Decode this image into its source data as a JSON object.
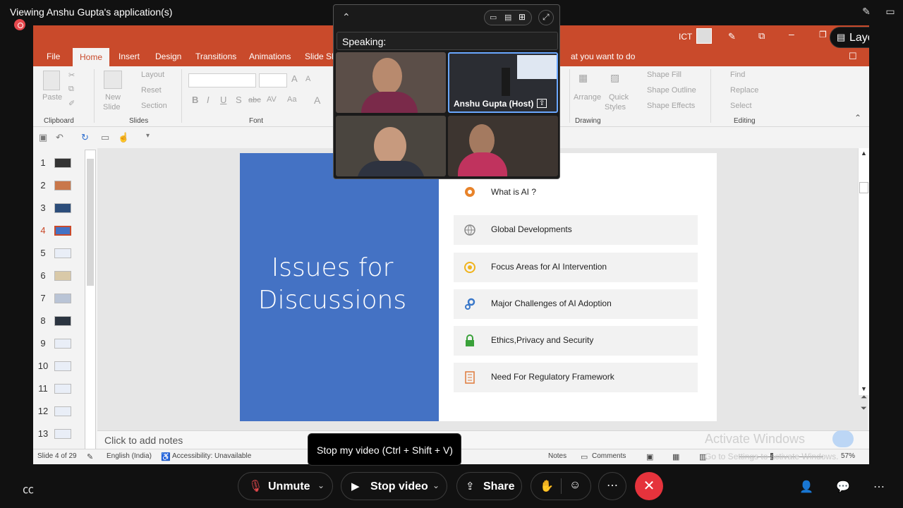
{
  "zoom": {
    "viewing_title": "Viewing Anshu Gupta's application(s)",
    "layout_label": "Layout",
    "speaking_label": "Speaking:",
    "participants": [
      "",
      "Anshu Gupta (Host)",
      "",
      ""
    ],
    "tooltip": "Stop my video (Ctrl + Shift + V)",
    "toolbar": {
      "unmute": "Unmute",
      "stop_video": "Stop video",
      "share": "Share"
    }
  },
  "ppt": {
    "user_label": "ICT",
    "tabs": [
      "File",
      "Home",
      "Insert",
      "Design",
      "Transitions",
      "Animations",
      "Slide Sh"
    ],
    "tell_me": "at you want to do",
    "ribbon": {
      "clipboard": {
        "paste": "Paste",
        "group": "Clipboard"
      },
      "slides": {
        "new_slide": "New",
        "new_slide2": "Slide",
        "layout": "Layout",
        "reset": "Reset",
        "section": "Section",
        "group": "Slides"
      },
      "font": {
        "group": "Font"
      },
      "drawing": {
        "arrange": "Arrange",
        "quick": "Quick",
        "styles": "Styles",
        "shape_fill": "Shape Fill",
        "shape_outline": "Shape Outline",
        "shape_effects": "Shape Effects",
        "group": "Drawing"
      },
      "editing": {
        "find": "Find",
        "replace": "Replace",
        "select": "Select",
        "group": "Editing"
      }
    },
    "thumbnails": [
      "1",
      "2",
      "3",
      "4",
      "5",
      "6",
      "7",
      "8",
      "9",
      "10",
      "11",
      "12",
      "13"
    ],
    "active_slide": 4,
    "slide": {
      "title": "Issues for Discussions",
      "items": [
        {
          "label": "What is AI ?",
          "icon": "head-gears-icon"
        },
        {
          "label": "Global Developments",
          "icon": "globe-icon"
        },
        {
          "label": "Focus Areas for AI Intervention",
          "icon": "target-icon"
        },
        {
          "label": "Major Challenges of AI Adoption",
          "icon": "gears-icon"
        },
        {
          "label": "Ethics,Privacy and Security",
          "icon": "lock-icon"
        },
        {
          "label": "Need For Regulatory Framework",
          "icon": "checklist-icon"
        }
      ]
    },
    "notes_placeholder": "Click to add notes",
    "status": {
      "slide_of": "Slide 4 of 29",
      "language": "English (India)",
      "accessibility": "Accessibility: Unavailable",
      "notes": "Notes",
      "comments": "Comments",
      "zoom": "57%"
    },
    "watermark": {
      "title": "Activate Windows",
      "subtitle": "Go to Settings to activate Windows."
    }
  },
  "colors": {
    "ppt_accent": "#c94a2b",
    "slide_blue": "#4472c4",
    "leave_red": "#e5333c"
  }
}
